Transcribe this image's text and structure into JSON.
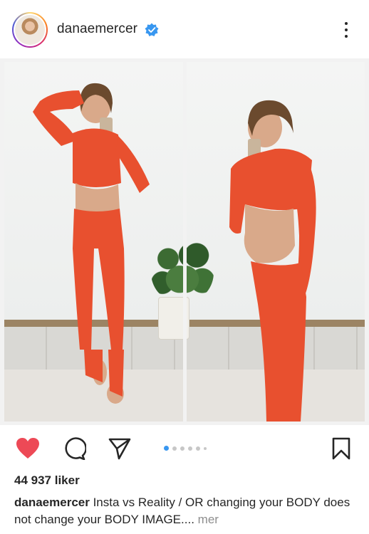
{
  "post": {
    "username": "danaemercer",
    "verified": true,
    "likes_text": "44 937 liker",
    "caption_text": "Insta vs Reality / OR changing your BODY does not change your BODY IMAGE....",
    "more_label": "mer",
    "carousel": {
      "total": 6,
      "active_index": 0
    }
  },
  "icons": {
    "avatar": "profile-avatar",
    "verified": "verified-badge-icon",
    "more": "more-options-icon",
    "like": "heart-icon",
    "comment": "comment-icon",
    "share": "paper-plane-icon",
    "save": "bookmark-icon"
  },
  "colors": {
    "like_red": "#ed4956",
    "verified_blue": "#3897f0",
    "outfit_orange": "#e8502f",
    "text": "#262626",
    "muted": "#8e8e8e"
  }
}
